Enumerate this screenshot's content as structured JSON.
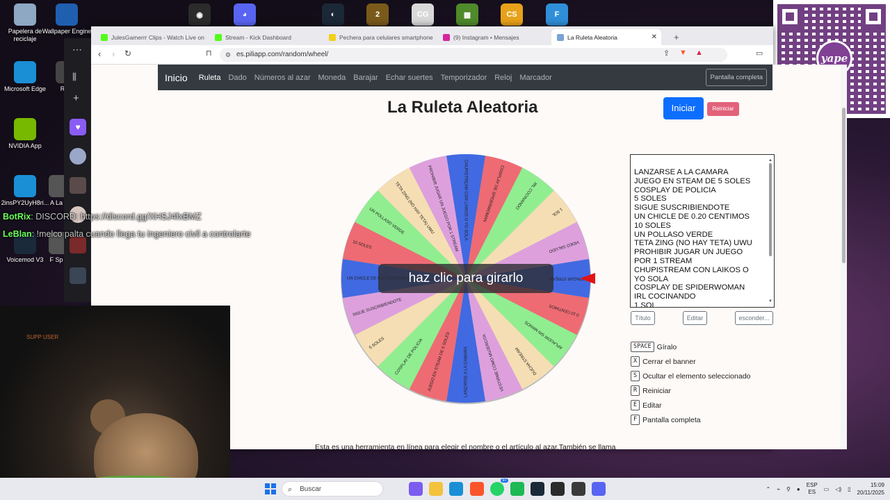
{
  "desktop": {
    "icons": [
      {
        "label": "Papelera de reciclaje",
        "color": "#8ea7c2"
      },
      {
        "label": "Wallpaper Engine",
        "color": "#1f5fb0"
      },
      {
        "label": "Microsoft Edge",
        "color": "#1a8fd6"
      },
      {
        "label": "Robl",
        "color": "#444"
      },
      {
        "label": "NVIDIA App",
        "color": "#76b900"
      },
      {
        "label": "2insPY2UyH8ri...",
        "color": "#1a8fd6"
      },
      {
        "label": "A La",
        "color": "#555"
      },
      {
        "label": "Voicemod V3",
        "color": "#1b2a3a"
      },
      {
        "label": "F Sp",
        "color": "#555"
      }
    ],
    "top_icons": [
      {
        "name": "obs-icon",
        "color": "#2b2b2b",
        "glyph": "◉"
      },
      {
        "name": "discord-icon",
        "color": "#5865f2",
        "glyph": "◕"
      },
      {
        "name": "steam-icon",
        "color": "#1b2838",
        "glyph": "◐"
      },
      {
        "name": "game-icon",
        "color": "#7a5a1a",
        "glyph": "2"
      },
      {
        "name": "crab-game-icon",
        "color": "#d9d9d9",
        "glyph": "CG"
      },
      {
        "name": "minecraft-icon",
        "color": "#4f8a2b",
        "glyph": "▦"
      },
      {
        "name": "counter-strike-icon",
        "color": "#e8a21a",
        "glyph": "CS"
      },
      {
        "name": "fortnite-icon",
        "color": "#2f8fd8",
        "glyph": "F"
      }
    ]
  },
  "qr": {
    "brand": "yape"
  },
  "chat": [
    {
      "user": "BotRix",
      "message": ": DISCORD: https://discord.gg/XHSJ4fxBMZ",
      "color": "#6cff5c"
    },
    {
      "user": "LeBlan",
      "message": ": !melco palta cuando llega tu ingeniero civil a controlarte",
      "color": "#6cff5c"
    }
  ],
  "webcam": {
    "label": "SUPP USER"
  },
  "browser": {
    "tabs": [
      {
        "label": "JulesGamerrr Clips - Watch Live on K",
        "color": "#53fc18"
      },
      {
        "label": "Stream - Kick Dashboard",
        "color": "#53fc18"
      },
      {
        "label": "Pechera para celulares smartphone o",
        "color": "#f2d01a"
      },
      {
        "label": "(9) Instagram • Mensajes",
        "color": "#d6249f"
      },
      {
        "label": "La Ruleta Aleatoria",
        "color": "#7aa2d6"
      }
    ],
    "url": "es.piliapp.com/random/wheel/"
  },
  "site": {
    "brand": "Inicio",
    "nav": [
      "Ruleta",
      "Dado",
      "Números al azar",
      "Moneda",
      "Barajar",
      "Echar suertes",
      "Temporizador",
      "Reloj",
      "Marcador"
    ],
    "fullscreen": "Pantalla completa",
    "title": "La Ruleta Aleatoria",
    "start": "Iniciar",
    "reset": "Reiniciar",
    "spin_prompt": "haz clic para girarlo",
    "options": [
      "LANZARSE A LA CAMARA",
      "JUEGO EN STEAM DE 5 SOLES",
      "COSPLAY DE POLICIA",
      "5 SOLES",
      "SIGUE SUSCRIBIENDOTE",
      "UN CHICLE DE 0.20 CENTIMOS",
      "10 SOLES",
      "UN POLLASO VERDE",
      "TETA ZING (NO HAY TETA) UWU",
      "PROHIBIR JUGAR UN JUEGO",
      "POR 1 STREAM",
      "CHUPISTREAM CON LAIKOS O",
      "YO SOLA",
      "COSPLAY DE SPIDERWOMAN",
      "IRL COCINANDO",
      "1 SOL"
    ],
    "buttons": {
      "title": "Título",
      "edit": "Editar",
      "hide": "esconder..."
    },
    "shortcuts": [
      {
        "key": "SPACE",
        "label": "Gíralo"
      },
      {
        "key": "X",
        "label": "Cerrar el banner"
      },
      {
        "key": "S",
        "label": "Ocultar el elemento seleccionado"
      },
      {
        "key": "R",
        "label": "Reiniciar"
      },
      {
        "key": "E",
        "label": "Editar"
      },
      {
        "key": "F",
        "label": "Pantalla completa"
      }
    ],
    "description": "Esta es una herramienta en línea para elegir el nombre o el artículo al azar.También se llama selector de nombres aleatorios, rueda de nombres o ruleta en línea.A veces es difícil para las personas tomar decisiones. Luego haga una lista de opciones o candidatos existentes y"
  },
  "wheel": {
    "segments": [
      {
        "label": "CHUPISTREAM CON LAIKOS O YO SOLA",
        "color": "#4169e1"
      },
      {
        "label": "COSPLAY DE SPIDERWOMAN",
        "color": "#ee6b73"
      },
      {
        "label": "IRL COCINANDO",
        "color": "#90ee90"
      },
      {
        "label": "1 SOL",
        "color": "#f5deb3"
      },
      {
        "label": "VIDEO SALUDO",
        "color": "#dda0dd"
      },
      {
        "label": "APAGAR STREAM",
        "color": "#4169e1"
      },
      {
        "label": "0.10 CENTIMOS",
        "color": "#ee6b73"
      },
      {
        "label": "APLAUDIR SIN MANOS",
        "color": "#90ee90"
      },
      {
        "label": "DUCHA STREAM",
        "color": "#f5deb3"
      },
      {
        "label": "VESTIRME COMO MUJERCITA",
        "color": "#dda0dd"
      },
      {
        "label": "LANZARSE A LA CAMARA",
        "color": "#4169e1"
      },
      {
        "label": "JUEGO EN STEAM DE 5 SOLES",
        "color": "#ee6b73"
      },
      {
        "label": "COSPLAY DE POLICIA",
        "color": "#90ee90"
      },
      {
        "label": "5 SOLES",
        "color": "#f5deb3"
      },
      {
        "label": "SIGUE SUSCRIBIENDOTE",
        "color": "#dda0dd"
      },
      {
        "label": "UN CHICLE DE 0.20 CENTIMOS",
        "color": "#4169e1"
      },
      {
        "label": "10 SOLES",
        "color": "#ee6b73"
      },
      {
        "label": "UN POLLASO VERDE",
        "color": "#90ee90"
      },
      {
        "label": "TETA ZING (NO HAY TETA) UWU",
        "color": "#f5deb3"
      },
      {
        "label": "PROHIBIR JUGAR UN JUEGO POR 1 STREAM",
        "color": "#dda0dd"
      }
    ],
    "pointer_color": "#e31313"
  },
  "taskbar": {
    "search": "Buscar",
    "apps": [
      {
        "name": "copilot-icon",
        "color": "#7b5cf0"
      },
      {
        "name": "file-explorer-icon",
        "color": "#f3c33d"
      },
      {
        "name": "edge-icon",
        "color": "#1a8fd6"
      },
      {
        "name": "brave-icon",
        "color": "#fb542b"
      },
      {
        "name": "whatsapp-icon",
        "color": "#25d366"
      },
      {
        "name": "spotify-icon",
        "color": "#1db954"
      },
      {
        "name": "steam-icon",
        "color": "#1b2838"
      },
      {
        "name": "obs-icon",
        "color": "#2b2b2b"
      },
      {
        "name": "game-bar-icon",
        "color": "#3a3a3a"
      },
      {
        "name": "discord-icon",
        "color": "#5865f2"
      }
    ],
    "whatsapp_badge": "97",
    "language_top": "ESP",
    "language_bottom": "ES",
    "time": "15:09",
    "date": "20/11/2025"
  }
}
